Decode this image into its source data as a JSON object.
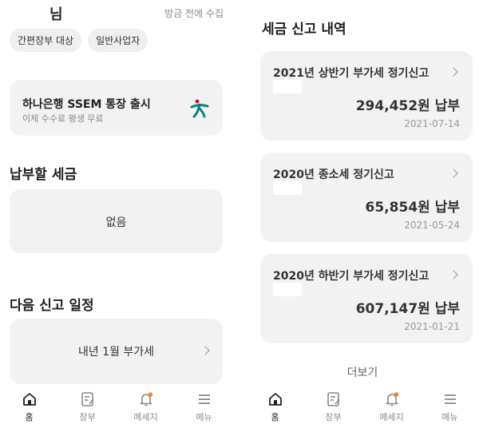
{
  "left": {
    "greeting": "님",
    "update_status": "방금 전에 수집",
    "chips": [
      "간편장부 대상",
      "일반사업자"
    ],
    "bank_card": {
      "title": "하나은행 SSEM 통장 출시",
      "subtitle": "이체 수수료 평생 무료",
      "logo": "hana-bank-logo",
      "logo_color": "#00857c",
      "logo_accent": "#e4002b"
    },
    "tax_due": {
      "title": "납부할 세금",
      "value": "없음"
    },
    "schedule": {
      "title": "다음 신고 일정",
      "item": "내년 1월 부가세"
    }
  },
  "right": {
    "title": "세금 신고 내역",
    "history": [
      {
        "title": "2021년 상반기 부가세 정기신고",
        "amount": "294,452원 납부",
        "date": "2021-07-14"
      },
      {
        "title": "2020년 종소세 정기신고",
        "amount": "65,854원 납부",
        "date": "2021-05-24"
      },
      {
        "title": "2020년 하반기 부가세 정기신고",
        "amount": "607,147원 납부",
        "date": "2021-01-21"
      }
    ],
    "more": "더보기"
  },
  "nav": [
    {
      "label": "홈",
      "icon": "home-icon",
      "active": true
    },
    {
      "label": "장부",
      "icon": "ledger-icon",
      "active": false
    },
    {
      "label": "메세지",
      "icon": "bell-icon",
      "active": false,
      "badge_color": "#ff7a1a"
    },
    {
      "label": "메뉴",
      "icon": "menu-icon",
      "active": false
    }
  ]
}
